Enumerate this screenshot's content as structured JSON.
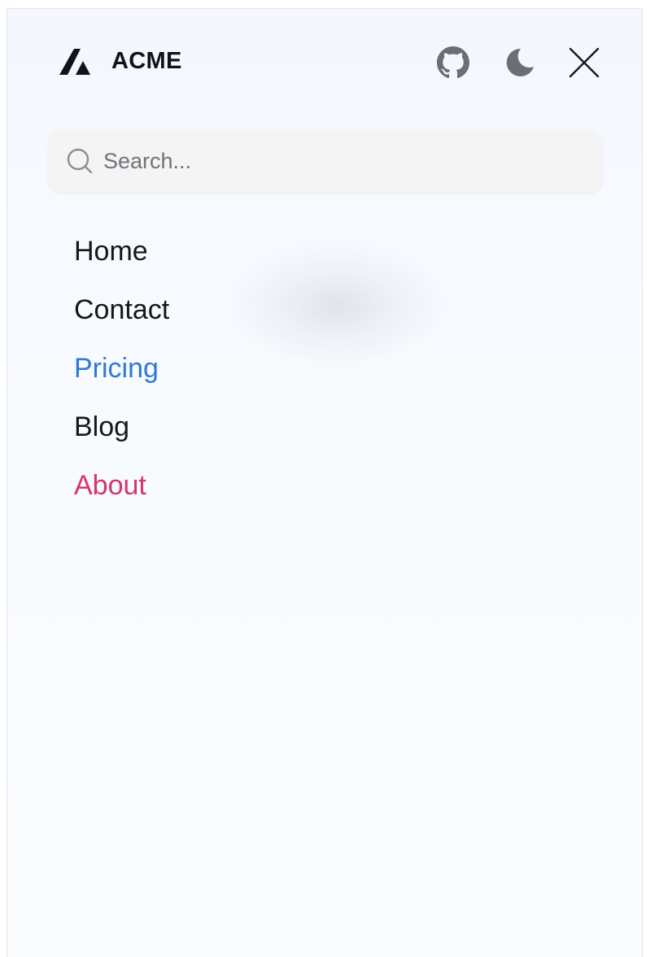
{
  "brand": {
    "name": "ACME",
    "logo_icon": "acme-logo-icon"
  },
  "header": {
    "actions": [
      {
        "name": "github-icon",
        "label": "GitHub"
      },
      {
        "name": "moon-icon",
        "label": "Toggle theme"
      },
      {
        "name": "close-icon",
        "label": "Close menu"
      }
    ]
  },
  "search": {
    "placeholder": "Search...",
    "value": ""
  },
  "nav": {
    "items": [
      {
        "label": "Home",
        "color": "#15171b"
      },
      {
        "label": "Contact",
        "color": "#15171b"
      },
      {
        "label": "Pricing",
        "color": "#2f78d8"
      },
      {
        "label": "Blog",
        "color": "#15171b"
      },
      {
        "label": "About",
        "color": "#d6356a"
      }
    ]
  },
  "colors": {
    "accent_blue": "#2f78d8",
    "accent_pink": "#d6356a",
    "text": "#15171b",
    "icon_gray": "#6b6e74"
  }
}
